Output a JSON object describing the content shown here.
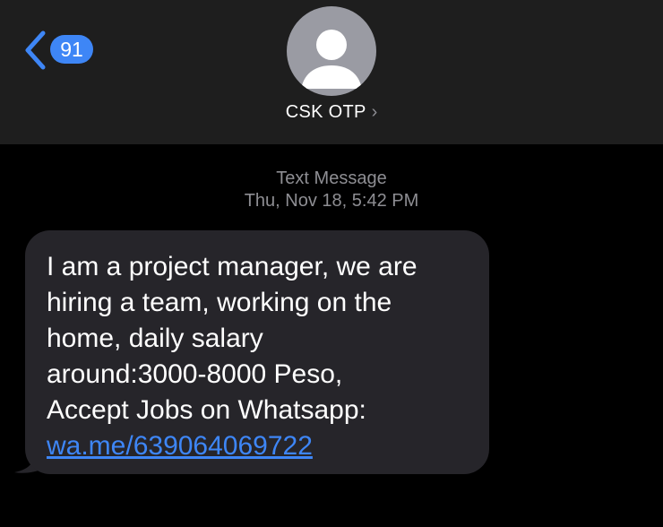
{
  "header": {
    "unread_count": "91",
    "contact_name": "CSK OTP",
    "contact_chevron": "›",
    "icons": {
      "back": "chevron-left-icon",
      "avatar": "person-silhouette-icon",
      "contact_detail": "chevron-right-icon"
    }
  },
  "thread": {
    "message_type": "Text Message",
    "timestamp": "Thu, Nov 18, 5:42 PM"
  },
  "message": {
    "lines": [
      "I am a project manager, we are",
      "hiring a team, working on the",
      "home, daily salary",
      "around:3000-8000 Peso,",
      "Accept Jobs on Whatsapp:"
    ],
    "link": "wa.me/639064069722"
  },
  "colors": {
    "accent_blue": "#3e86f6",
    "header_bg": "#1e1e1e",
    "bubble_bg": "#26252a",
    "avatar_bg": "#9a9ba3",
    "meta_gray": "#8e8e93"
  }
}
